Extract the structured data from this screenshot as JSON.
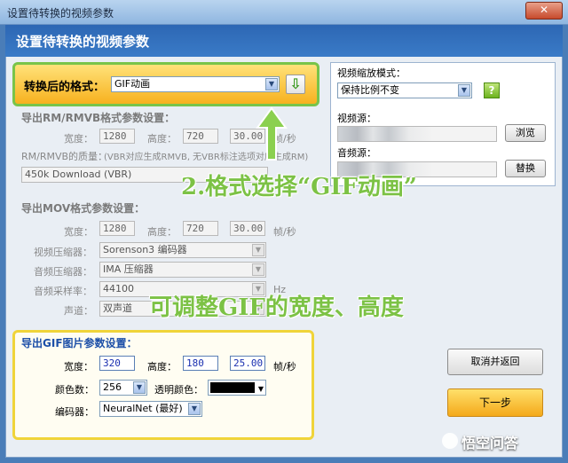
{
  "window": {
    "title": "设置待转换的视频参数",
    "close_glyph": "✕"
  },
  "header": {
    "title": "设置待转换的视频参数"
  },
  "format": {
    "label": "转换后的格式：",
    "value": "GIF动画"
  },
  "rm": {
    "section": "导出RM/RMVB格式参数设置：",
    "width_label": "宽度：",
    "width": "1280",
    "height_label": "高度：",
    "height": "720",
    "fps": "30.00",
    "fps_unit": "帧/秒",
    "quality_label": "RM/RMVB的质量：",
    "quality_note": "(VBR对应生成RMVB, 无VBR标注选项对应生成RM)",
    "quality_value": "450k Download (VBR)"
  },
  "mov": {
    "section": "导出MOV格式参数设置：",
    "width_label": "宽度：",
    "width": "1280",
    "height_label": "高度：",
    "height": "720",
    "fps": "30.00",
    "fps_unit": "帧/秒",
    "vcodec_label": "视频压缩器：",
    "vcodec": "Sorenson3 编码器",
    "acodec_label": "音频压缩器：",
    "acodec": "IMA 压缩器",
    "rate_label": "音频采样率：",
    "rate": "44100",
    "rate_unit": "Hz",
    "channel_label": "声道：",
    "channel": "双声道"
  },
  "gif": {
    "section": "导出GIF图片参数设置：",
    "width_label": "宽度：",
    "width": "320",
    "height_label": "高度：",
    "height": "180",
    "fps": "25.00",
    "fps_unit": "帧/秒",
    "colors_label": "颜色数：",
    "colors": "256",
    "transparent_label": "透明颜色：",
    "transparent_color": "#000000",
    "encoder_label": "编码器：",
    "encoder": "NeuralNet (最好)"
  },
  "right": {
    "scale_label": "视频缩放模式：",
    "scale_value": "保持比例不变",
    "help_glyph": "?",
    "video_src_label": "视频源：",
    "browse": "浏览",
    "audio_src_label": "音频源：",
    "replace": "替换"
  },
  "buttons": {
    "cancel": "取消并返回",
    "next": "下一步"
  },
  "annotations": {
    "step2": "2.格式选择“GIF动画”",
    "resize": "可调整GIF的宽度、高度"
  },
  "watermark": "悟空问答",
  "colors": {
    "accent_green": "#7cc245",
    "header_blue": "#2d67b4",
    "gif_border": "#f0d43a"
  }
}
